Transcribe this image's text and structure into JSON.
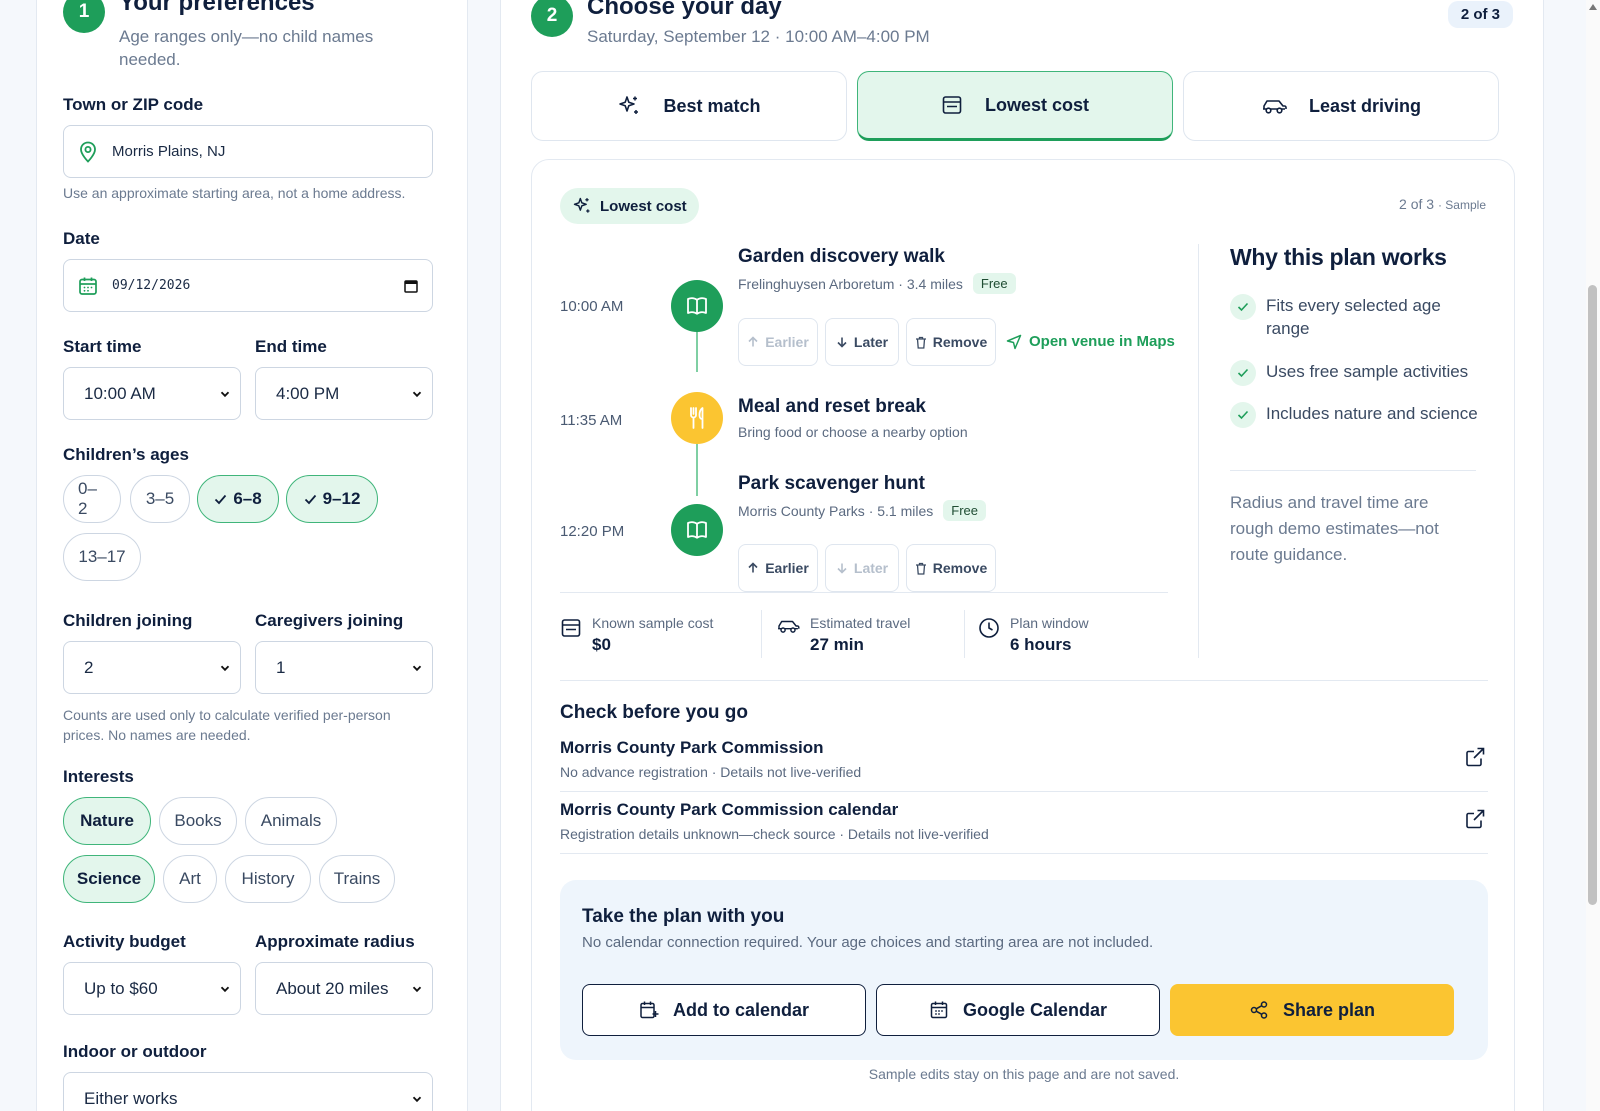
{
  "prefs": {
    "step": "1",
    "title": "Your preferences",
    "subtitle": "Age ranges only—no child names needed.",
    "town_label": "Town or ZIP code",
    "town_value": "Morris Plains, NJ",
    "town_hint": "Use an approximate starting area, not a home address.",
    "date_label": "Date",
    "date_value": "09/12/2026",
    "start_label": "Start time",
    "start_value": "10:00 AM",
    "end_label": "End time",
    "end_value": "4:00 PM",
    "ages_label": "Children’s ages",
    "ages": [
      {
        "label": "0–2",
        "selected": false
      },
      {
        "label": "3–5",
        "selected": false
      },
      {
        "label": "6–8",
        "selected": true
      },
      {
        "label": "9–12",
        "selected": true
      },
      {
        "label": "13–17",
        "selected": false
      }
    ],
    "children_label": "Children joining",
    "children_value": "2",
    "caregivers_label": "Caregivers joining",
    "caregivers_value": "1",
    "counts_hint": "Counts are used only to calculate verified per-person prices. No names are needed.",
    "interests_label": "Interests",
    "interests": [
      {
        "label": "Nature",
        "selected": true
      },
      {
        "label": "Books",
        "selected": false
      },
      {
        "label": "Animals",
        "selected": false
      },
      {
        "label": "Science",
        "selected": true
      },
      {
        "label": "Art",
        "selected": false
      },
      {
        "label": "History",
        "selected": false
      },
      {
        "label": "Trains",
        "selected": false
      }
    ],
    "budget_label": "Activity budget",
    "budget_value": "Up to $60",
    "radius_label": "Approximate radius",
    "radius_value": "About 20 miles",
    "indoor_label": "Indoor or outdoor",
    "indoor_value": "Either works"
  },
  "day": {
    "step": "2",
    "title": "Choose your day",
    "subtitle": "Saturday, September 12 · 10:00 AM–4:00 PM",
    "count_badge": "2 of 3",
    "tabs": [
      {
        "label": "Best match",
        "icon": "sparkle-icon",
        "selected": false
      },
      {
        "label": "Lowest cost",
        "icon": "wallet-icon",
        "selected": true
      },
      {
        "label": "Least driving",
        "icon": "car-icon",
        "selected": false
      }
    ],
    "plan_pill": "Lowest cost",
    "plan_counter": "2 of 3",
    "plan_counter_tag": "· Sample",
    "activities": [
      {
        "time": "10:00 AM",
        "title": "Garden discovery walk",
        "meta": "Frelinghuysen Arboretum · 3.4 miles",
        "tag": "Free",
        "icon": "book-icon",
        "btn_earlier": "Earlier",
        "btn_later": "Later",
        "btn_remove": "Remove",
        "maps_link": "Open venue in Maps"
      },
      {
        "time": "11:35 AM",
        "title": "Meal and reset break",
        "meta": "Bring food or choose a nearby option",
        "icon": "utensils-icon"
      },
      {
        "time": "12:20 PM",
        "title": "Park scavenger hunt",
        "meta": "Morris County Parks · 5.1 miles",
        "tag": "Free",
        "icon": "book-icon",
        "btn_earlier": "Earlier",
        "btn_later": "Later",
        "btn_remove": "Remove"
      }
    ],
    "stats": [
      {
        "label": "Known sample cost",
        "value": "$0",
        "icon": "wallet-icon"
      },
      {
        "label": "Estimated travel",
        "value": "27 min",
        "icon": "car-icon"
      },
      {
        "label": "Plan window",
        "value": "6 hours",
        "icon": "clock-icon"
      }
    ],
    "why": {
      "title": "Why this plan works",
      "items": [
        "Fits every selected age range",
        "Uses free sample activities",
        "Includes nature and science"
      ],
      "note": "Radius and travel time are rough demo estimates—not route guidance."
    },
    "check": {
      "title": "Check before you go",
      "sources": [
        {
          "title": "Morris County Park Commission",
          "detail": "No advance registration · Details not live-verified"
        },
        {
          "title": "Morris County Park Commission calendar",
          "detail": "Registration details unknown—check source · Details not live-verified"
        }
      ]
    },
    "take": {
      "title": "Take the plan with you",
      "subtitle": "No calendar connection required. Your age choices and starting area are not included.",
      "btn_calendar": "Add to calendar",
      "btn_google": "Google Calendar",
      "btn_share": "Share plan"
    },
    "footnote": "Sample edits stay on this page and are not saved."
  },
  "colors": {
    "accent": "#1e9e5a",
    "accent_soft": "#e3f6ec",
    "yellow": "#fbc531",
    "navy": "#0f1f3d"
  }
}
